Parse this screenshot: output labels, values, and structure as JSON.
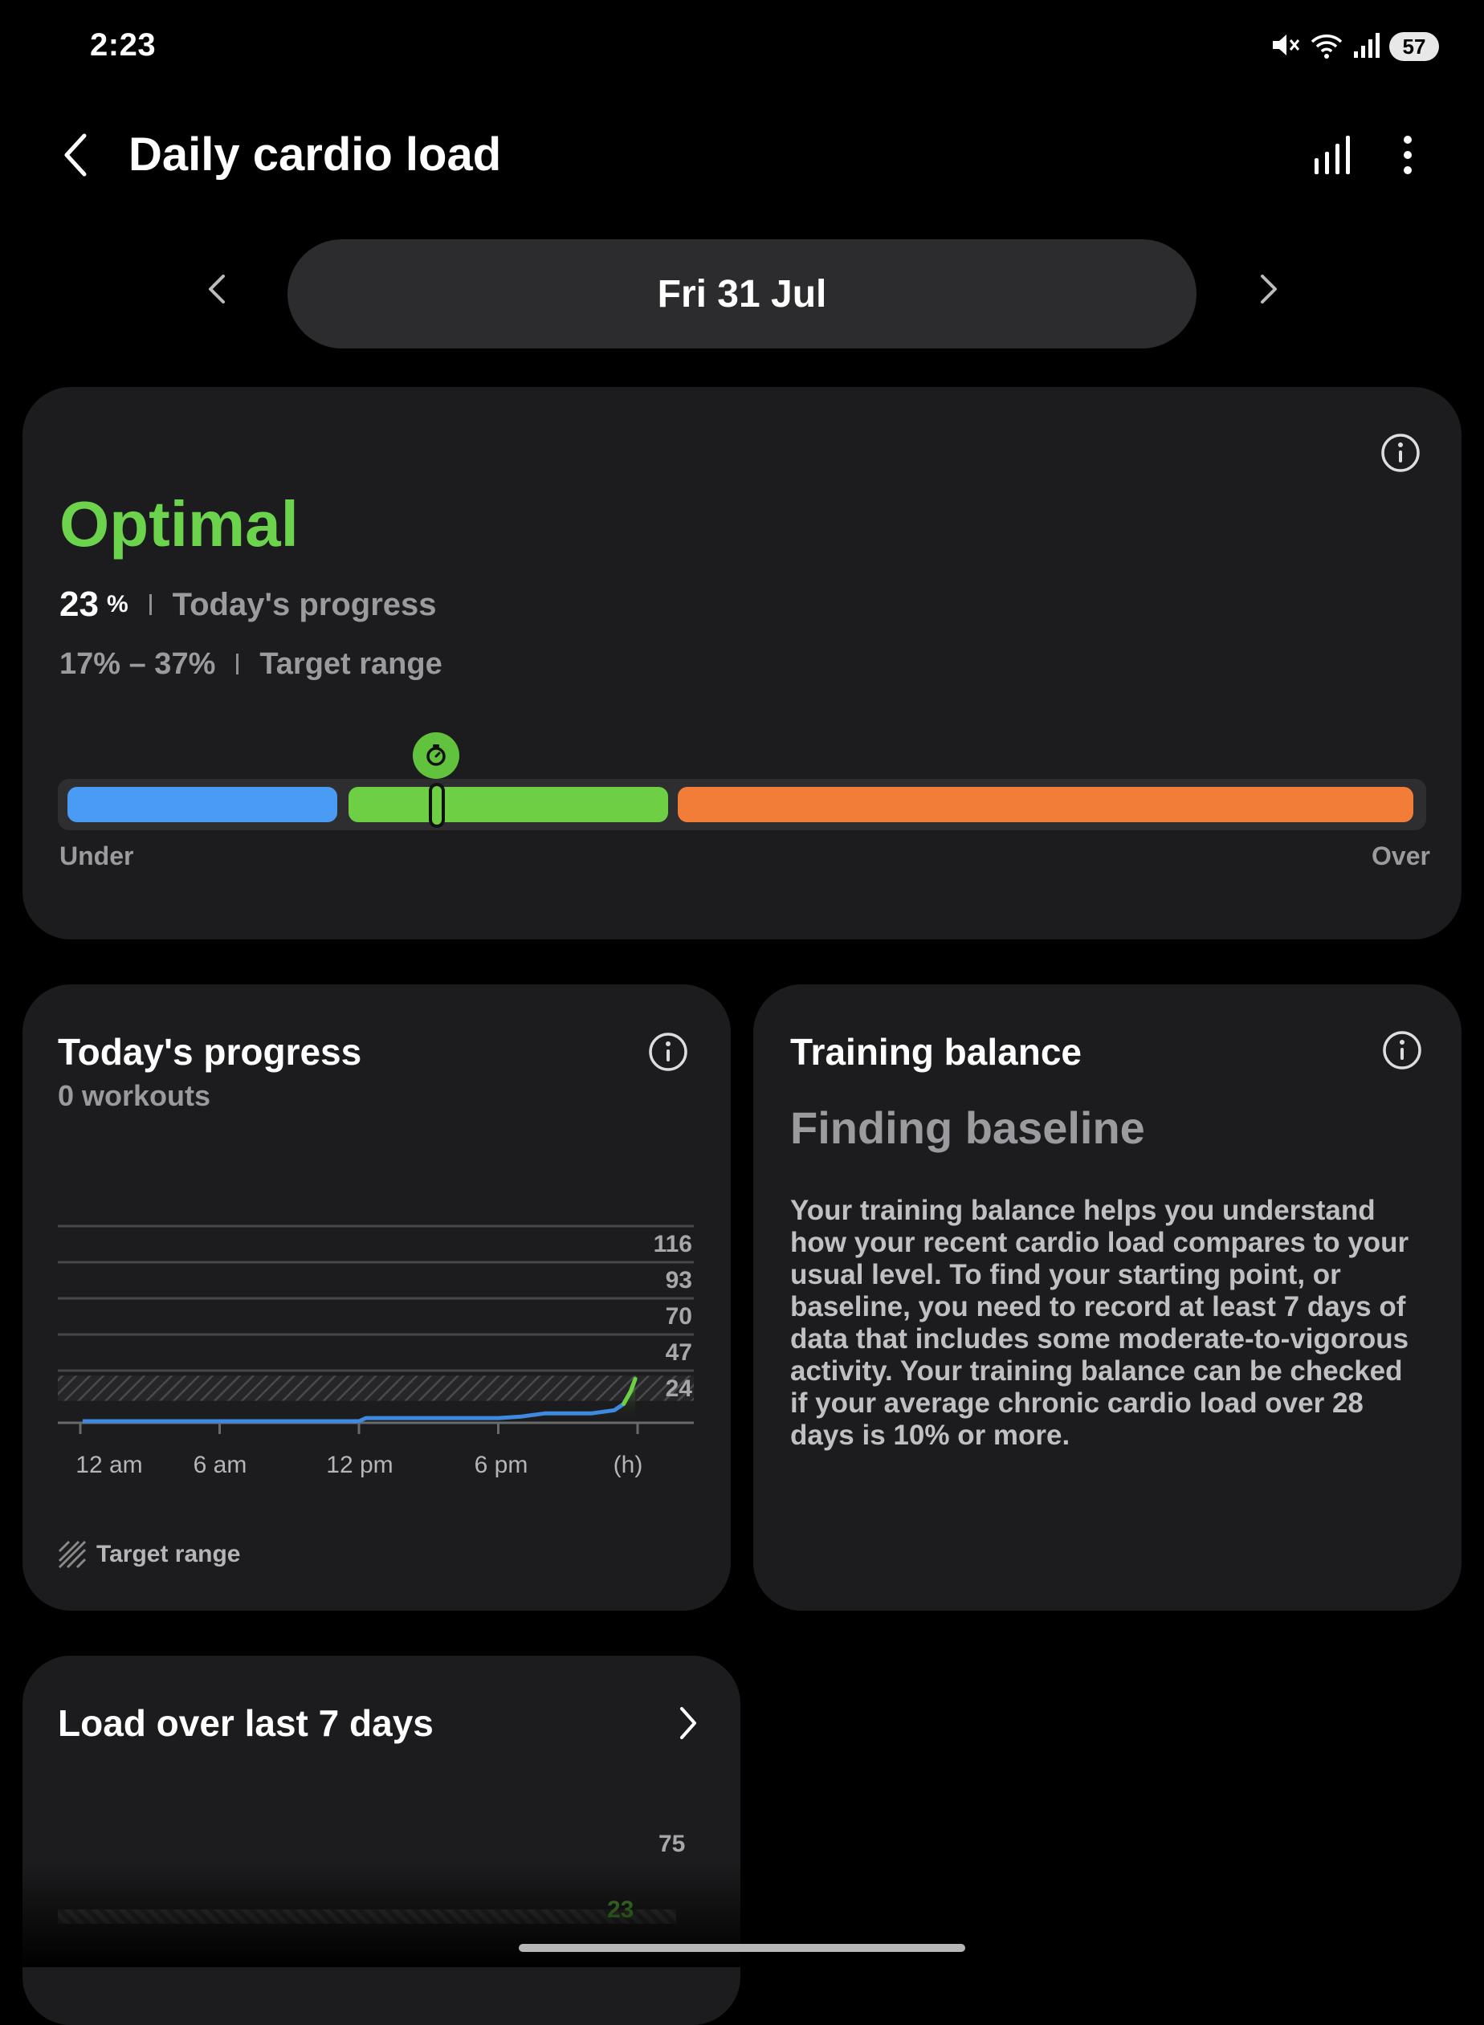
{
  "status_bar": {
    "time": "2:23",
    "battery": "57"
  },
  "header": {
    "title": "Daily cardio load"
  },
  "date_nav": {
    "date": "Fri 31 Jul"
  },
  "summary": {
    "status": "Optimal",
    "progress_value": "23",
    "progress_unit": "%",
    "progress_label": "Today's progress",
    "target_range": "17% – 37%",
    "target_label": "Target range",
    "scale_min_label": "Under",
    "scale_max_label": "Over",
    "marker_percent": 23,
    "colors": {
      "under": "#4a9bf3",
      "optimal": "#6ecf44",
      "over": "#f27d38",
      "status": "#6bd34c"
    }
  },
  "todays_progress": {
    "title": "Today's progress",
    "workouts": "0 workouts",
    "legend_label": "Target range",
    "chart_data": {
      "type": "line",
      "x_tick_labels": [
        "12 am",
        "6 am",
        "12 pm",
        "6 pm",
        "(h)"
      ],
      "y_tick_labels": [
        "116",
        "93",
        "70",
        "47",
        "24"
      ],
      "y_ticks": [
        116,
        93,
        70,
        47,
        24
      ],
      "ylim": [
        0,
        139
      ],
      "xlim": [
        0,
        24
      ],
      "target_band": [
        14,
        30
      ],
      "series": [
        {
          "color": "#3d8ae0",
          "points": [
            [
              0.1,
              1
            ],
            [
              6,
              1
            ],
            [
              12,
              1
            ],
            [
              12.3,
              3
            ],
            [
              18,
              3
            ],
            [
              19,
              4
            ],
            [
              20,
              6
            ],
            [
              22,
              6
            ],
            [
              23.0,
              8
            ],
            [
              23.4,
              12
            ],
            [
              23.7,
              20
            ],
            [
              23.9,
              28
            ]
          ]
        }
      ]
    }
  },
  "training_balance": {
    "title": "Training balance",
    "state": "Finding baseline",
    "description": "Your training balance helps you understand how your recent cardio load compares to your usual level. To find your starting point, or baseline, you need to record at least 7 days of data that includes some moderate-to-vigorous activity. Your training balance can be checked if your average chronic cardio load over 28 days is 10% or more."
  },
  "load_7_days": {
    "title": "Load over last 7 days",
    "y_tick_label": "75",
    "today_value": "23"
  }
}
